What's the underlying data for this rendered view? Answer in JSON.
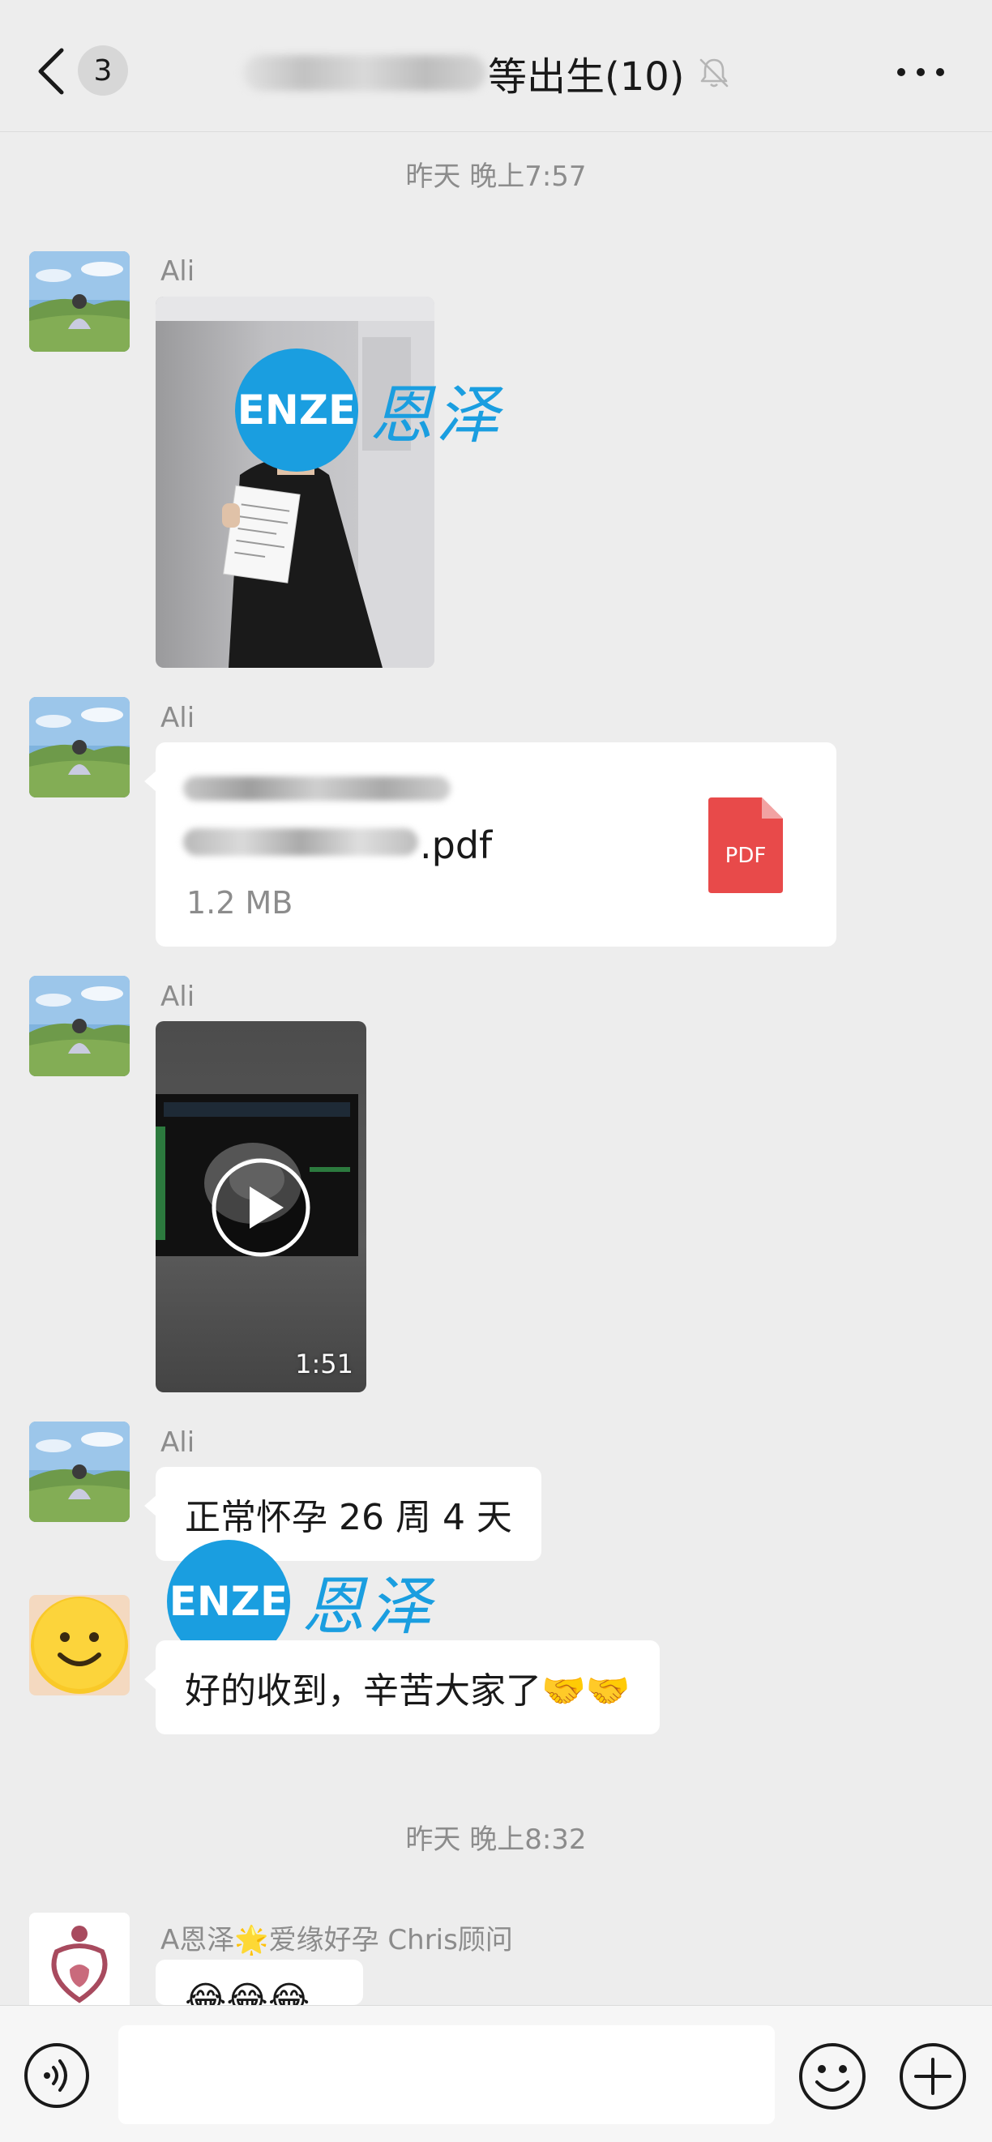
{
  "header": {
    "unread_count": "3",
    "title": "等出生(10)",
    "icons": [
      "chevron-left-icon",
      "bell-muted-icon",
      "more-icon"
    ]
  },
  "timestamps": [
    "昨天 晚上7:57",
    "昨天 晚上8:32"
  ],
  "watermark": {
    "logo_text": "ENZE",
    "brand_text": "恩泽"
  },
  "messages": [
    {
      "sender": "Ali",
      "type": "image"
    },
    {
      "sender": "Ali",
      "type": "file",
      "file_ext": ".pdf",
      "file_size": "1.2 MB",
      "file_icon_label": "PDF"
    },
    {
      "sender": "Ali",
      "type": "video",
      "duration": "1:51"
    },
    {
      "sender": "Ali",
      "type": "text",
      "text": "正常怀孕 26 周 4 天"
    },
    {
      "sender": "",
      "type": "text",
      "text": "好的收到，辛苦大家了🤝🤝"
    },
    {
      "sender": "A恩泽🌟爱缘好孕 Chris顾问",
      "type": "text",
      "text": "😂😂😂"
    }
  ],
  "input_bar": {
    "placeholder": "",
    "icons": [
      "voice-icon",
      "emoji-icon",
      "plus-icon"
    ]
  },
  "colors": {
    "background": "#ededed",
    "bubble": "#ffffff",
    "watermark_blue": "#1a9ee0",
    "pdf_red": "#e84a4a"
  }
}
